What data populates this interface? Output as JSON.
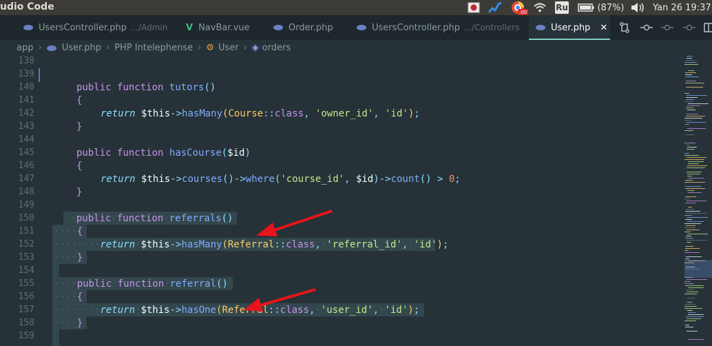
{
  "system_bar": {
    "app_title": "udio Code",
    "battery": "(87%)",
    "keyboard_layout": "Ru",
    "clock": "Yan 26 19:37",
    "badge": ".00"
  },
  "tabs": [
    {
      "label": "UsersController.php",
      "path": "…/Admin",
      "icon": "php-icon"
    },
    {
      "label": "NavBar.vue",
      "path": "",
      "icon": "vue-icon"
    },
    {
      "label": "Order.php",
      "path": "",
      "icon": "php-icon"
    },
    {
      "label": "UsersController.php",
      "path": "…/Controllers",
      "icon": "php-icon"
    },
    {
      "label": "User.php",
      "path": "",
      "icon": "php-icon",
      "active": true
    }
  ],
  "breadcrumb": {
    "segments": [
      "app",
      "User.php",
      "PHP Intelephense",
      "User",
      "orders"
    ]
  },
  "editor": {
    "line_numbers": [
      "138",
      "139",
      "140",
      "141",
      "142",
      "143",
      "144",
      "145",
      "146",
      "147",
      "148",
      "149",
      "150",
      "151",
      "152",
      "153",
      "154",
      "155",
      "156",
      "157",
      "158",
      "159"
    ]
  },
  "code": {
    "kw_public": "public",
    "kw_function": "function",
    "kw_return": "return",
    "this_var": "$this",
    "arrow": "->",
    "scope_op": "::",
    "kw_class": "class",
    "open_brace": "{",
    "close_brace": "}",
    "fn_tutors": "tutors",
    "fn_hasCourse": "hasCourse",
    "fn_referrals": "referrals",
    "fn_referral": "referral",
    "m_hasMany": "hasMany",
    "m_hasOne": "hasOne",
    "m_courses": "courses",
    "m_where": "where",
    "m_count": "count",
    "cls_course": "Course",
    "cls_referral": "Referral",
    "str_owner_id": "'owner_id'",
    "str_id": "'id'",
    "str_course_id": "'course_id'",
    "str_referral_id": "'referral_id'",
    "str_user_id": "'user_id'",
    "param_id": "$id",
    "num_zero": "0",
    "op_gt": ">"
  },
  "colors": {
    "editor_bg": "#263238",
    "keyword": "#c792ea",
    "function": "#82aaff",
    "string": "#c3e88d",
    "class": "#ffcb6b",
    "annotation_arrow": "#e8141b"
  }
}
